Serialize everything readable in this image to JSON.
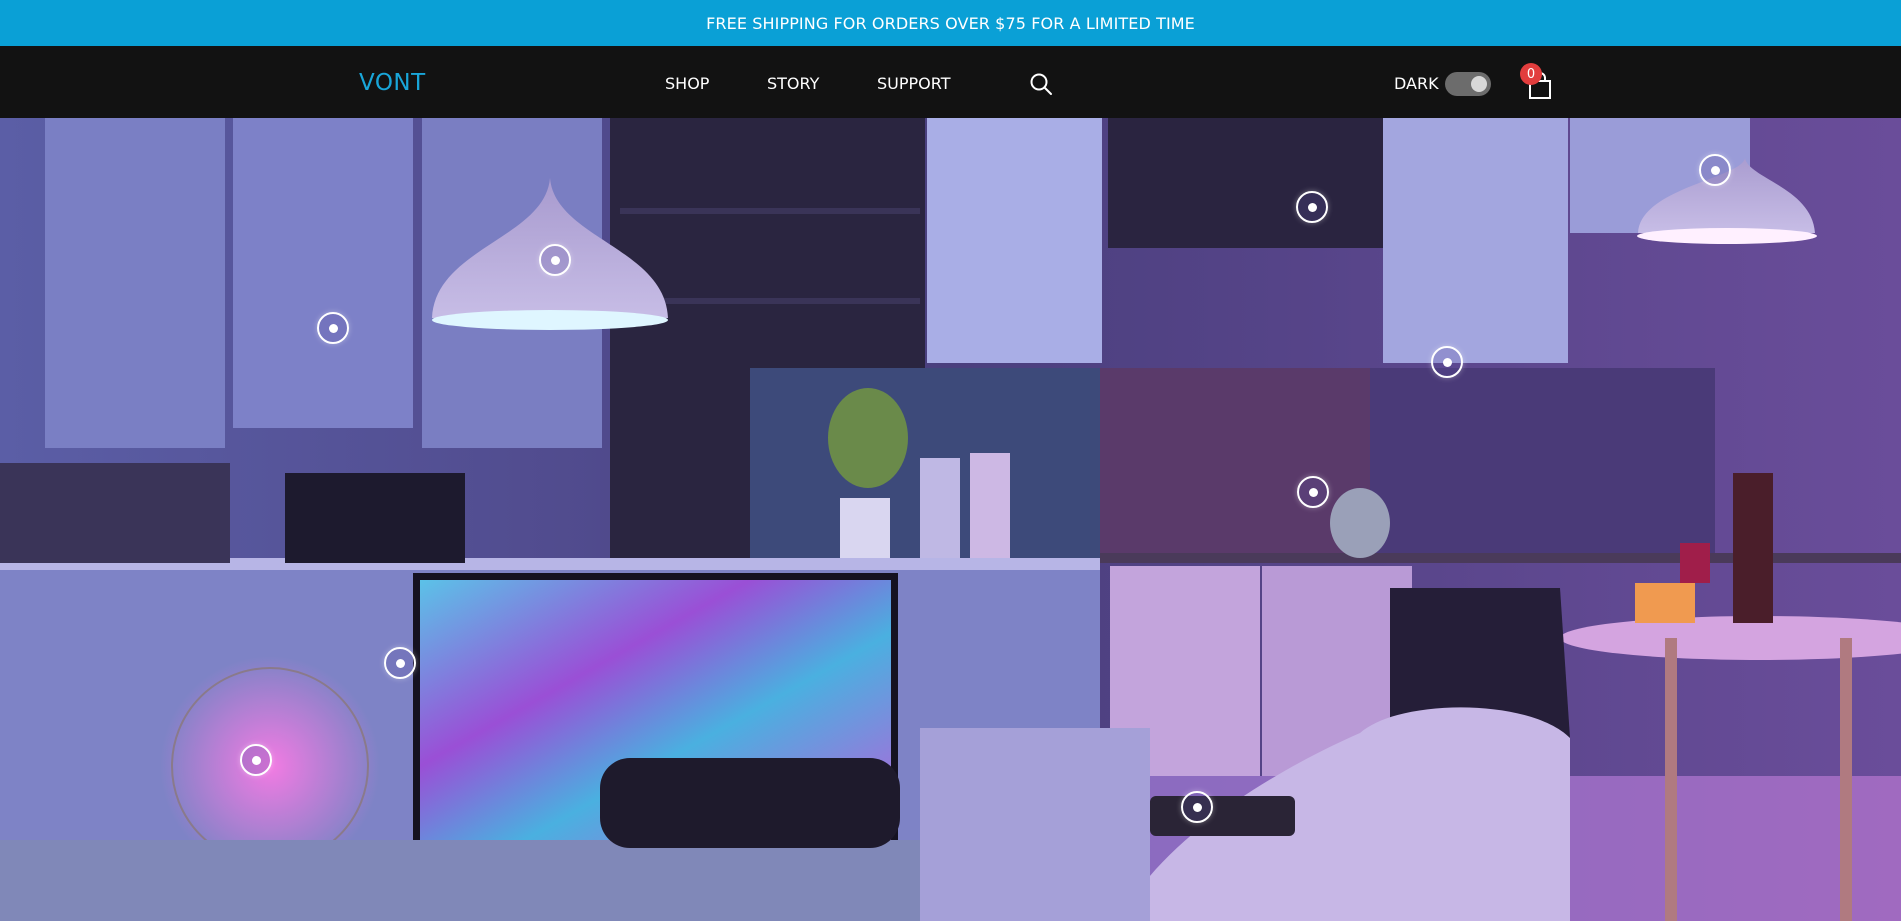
{
  "announcement": {
    "text": "FREE SHIPPING FOR ORDERS OVER $75 FOR A LIMITED TIME"
  },
  "header": {
    "logo": "VONT",
    "nav": [
      {
        "label": "SHOP"
      },
      {
        "label": "STORY"
      },
      {
        "label": "SUPPORT"
      }
    ],
    "search_icon": "search-icon",
    "dark_mode": {
      "label": "DARK",
      "enabled": true
    },
    "cart": {
      "icon": "shopping-bag-icon",
      "count": "0"
    }
  },
  "hero": {
    "scene": "smart home kitchen & living room",
    "hotspot_icon": "product-hotspot-icon",
    "colors": {
      "accent": "#0aa0d6",
      "nav_bg": "#121212",
      "badge": "#e23d3d"
    }
  }
}
